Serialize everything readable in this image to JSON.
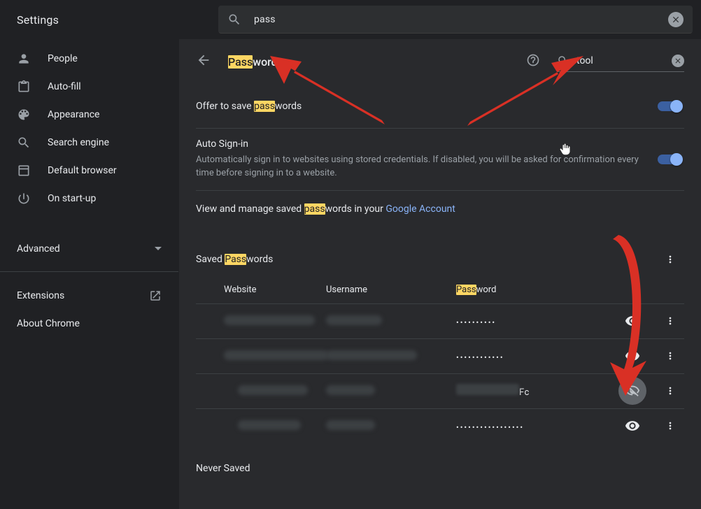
{
  "app_title": "Settings",
  "top_search": {
    "value": "pass"
  },
  "sidebar": {
    "items": [
      {
        "label": "People",
        "icon": "person-icon"
      },
      {
        "label": "Auto-fill",
        "icon": "clipboard-icon"
      },
      {
        "label": "Appearance",
        "icon": "palette-icon"
      },
      {
        "label": "Search engine",
        "icon": "search-icon"
      },
      {
        "label": "Default browser",
        "icon": "browser-icon"
      },
      {
        "label": "On start-up",
        "icon": "power-icon"
      }
    ],
    "advanced": "Advanced",
    "extensions": "Extensions",
    "about": "About Chrome"
  },
  "page": {
    "title_pre": "Pass",
    "title_post": "words",
    "inner_search": {
      "value": "tool"
    }
  },
  "offer_row": {
    "pre": "Offer to save ",
    "hl": "pass",
    "post": "words",
    "on": true
  },
  "autosignin": {
    "title": "Auto Sign-in",
    "desc": "Automatically sign in to websites using stored credentials. If disabled, you will be asked for confirmation every time before signing in to a website.",
    "on": true
  },
  "manage_line": {
    "pre": "View and manage saved ",
    "hl": "pass",
    "mid": "words in your ",
    "link": "Google Account"
  },
  "saved": {
    "head_pre": "Saved ",
    "head_hl": "Pass",
    "head_post": "words"
  },
  "table": {
    "cols": {
      "website": "Website",
      "username": "Username",
      "password_pre": "Pass",
      "password_post": "word"
    },
    "rows": [
      {
        "masked_len": 10,
        "revealed": false
      },
      {
        "masked_len": 12,
        "revealed": false
      },
      {
        "revealed": true,
        "password_suffix": "Fc"
      },
      {
        "masked_len": 17,
        "revealed": false
      }
    ]
  },
  "never_saved": "Never Saved"
}
